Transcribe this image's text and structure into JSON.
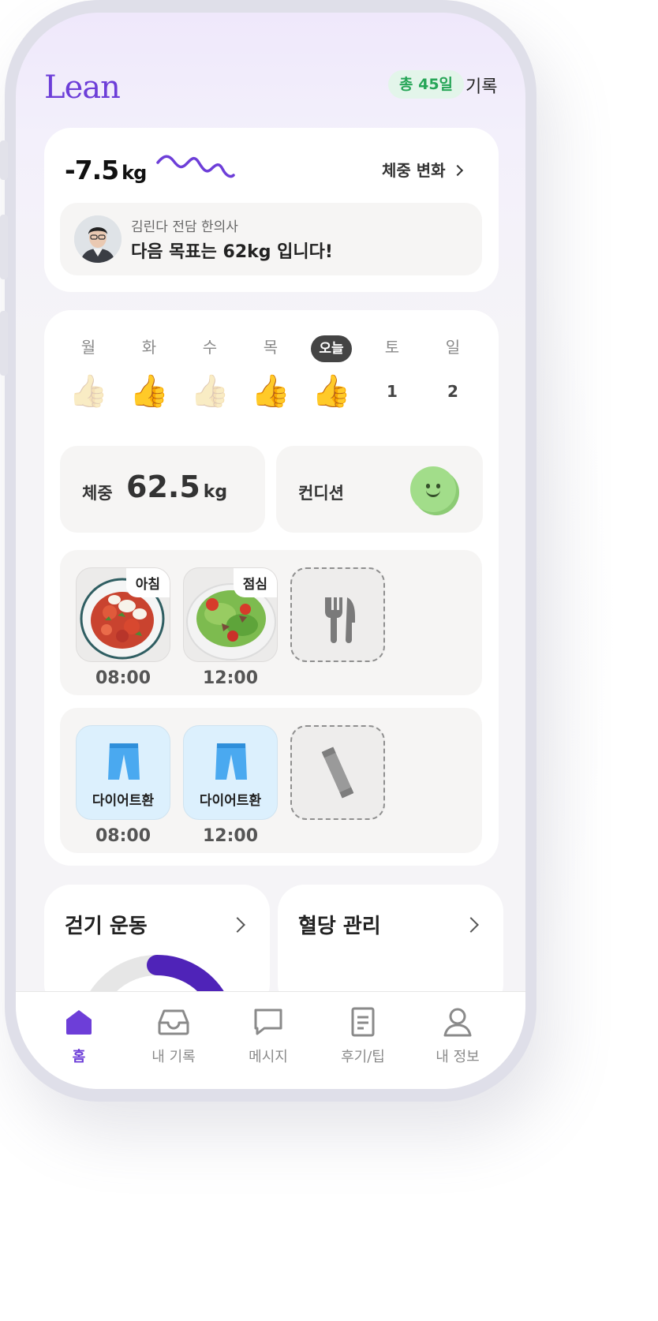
{
  "app": {
    "logo": "Lean",
    "accent_color": "#6d3ed8"
  },
  "header": {
    "total_days": "총 45일",
    "record_link": "기록"
  },
  "weight_summary": {
    "change_value": "-7.5",
    "change_unit": "kg",
    "trend_icon": "sparkline-icon",
    "link_label": "체중 변화"
  },
  "doctor": {
    "label": "김린다 전담 한의사",
    "message": "다음 목표는 62kg 입니다!"
  },
  "week": [
    {
      "label": "월",
      "mark": "👍",
      "done": false
    },
    {
      "label": "화",
      "mark": "👍",
      "done": true
    },
    {
      "label": "수",
      "mark": "👍",
      "done": false
    },
    {
      "label": "목",
      "mark": "👍",
      "done": true
    },
    {
      "label": "오늘",
      "mark": "👍",
      "done": true,
      "today": true
    },
    {
      "label": "토",
      "mark": "1"
    },
    {
      "label": "일",
      "mark": "2"
    }
  ],
  "stats": {
    "weight_label": "체중",
    "weight_value": "62.5",
    "weight_unit": "kg",
    "condition_label": "컨디션",
    "condition_icon": "smiley-icon"
  },
  "meals": [
    {
      "tag": "아침",
      "time": "08:00"
    },
    {
      "tag": "점심",
      "time": "12:00"
    }
  ],
  "meal_add_icon": "fork-knife-icon",
  "pills": [
    {
      "label": "다이어트환",
      "time": "08:00"
    },
    {
      "label": "다이어트환",
      "time": "12:00"
    }
  ],
  "pill_add_icon": "stick-pouch-icon",
  "cards": {
    "walk_title": "걷기 운동",
    "sugar_title": "혈당 관리"
  },
  "tabs": [
    {
      "label": "홈",
      "icon": "home-icon",
      "active": true
    },
    {
      "label": "내 기록",
      "icon": "inbox-icon"
    },
    {
      "label": "메시지",
      "icon": "message-icon"
    },
    {
      "label": "후기/팁",
      "icon": "document-icon"
    },
    {
      "label": "내 정보",
      "icon": "person-icon"
    }
  ]
}
